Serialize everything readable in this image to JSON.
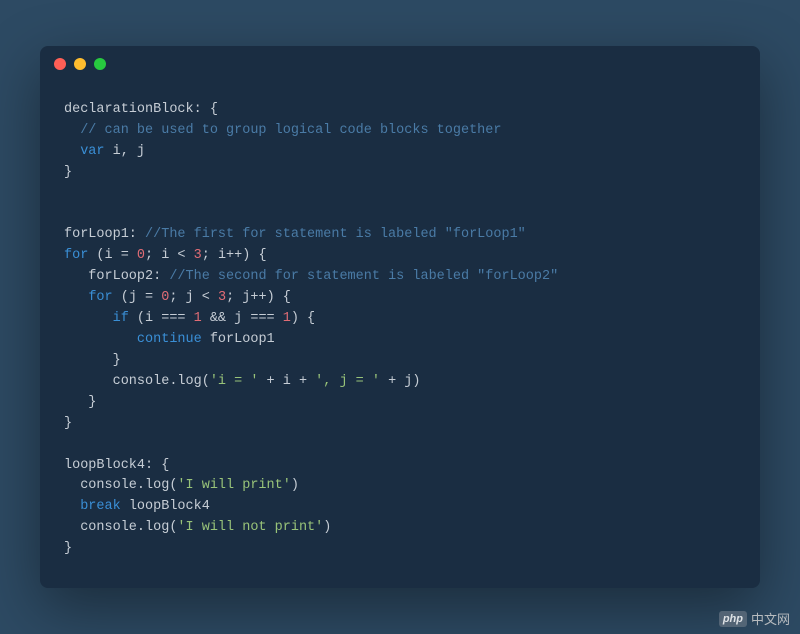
{
  "titlebar": {
    "dots": [
      "red",
      "yellow",
      "green"
    ]
  },
  "code": {
    "t1a": "declarationBlock: {",
    "t2a": "  ",
    "t2b": "// can be used to group logical code blocks together",
    "t3a": "  ",
    "t3b": "var",
    "t3c": " i, j",
    "t4a": "}",
    "t5a": "",
    "t6a": "",
    "t7a": "forLoop1: ",
    "t7b": "//The first for statement is labeled \"forLoop1\"",
    "t8a": "for",
    "t8b": " (i = ",
    "t8c": "0",
    "t8d": "; i < ",
    "t8e": "3",
    "t8f": "; i++) {",
    "t9a": "   forLoop2: ",
    "t9b": "//The second for statement is labeled \"forLoop2\"",
    "t10a": "   ",
    "t10b": "for",
    "t10c": " (j = ",
    "t10d": "0",
    "t10e": "; j < ",
    "t10f": "3",
    "t10g": "; j++) {",
    "t11a": "      ",
    "t11b": "if",
    "t11c": " (i === ",
    "t11d": "1",
    "t11e": " && j === ",
    "t11f": "1",
    "t11g": ") {",
    "t12a": "         ",
    "t12b": "continue",
    "t12c": " forLoop1",
    "t13a": "      }",
    "t14a": "      console.log(",
    "t14b": "'i = '",
    "t14c": " + i + ",
    "t14d": "', j = '",
    "t14e": " + j)",
    "t15a": "   }",
    "t16a": "}",
    "t17a": "",
    "t18a": "loopBlock4: {",
    "t19a": "  console.log(",
    "t19b": "'I will print'",
    "t19c": ")",
    "t20a": "  ",
    "t20b": "break",
    "t20c": " loopBlock4",
    "t21a": "  console.log(",
    "t21b": "'I will not print'",
    "t21c": ")",
    "t22a": "}"
  },
  "watermark": {
    "logo": "php",
    "text": "中文网"
  }
}
